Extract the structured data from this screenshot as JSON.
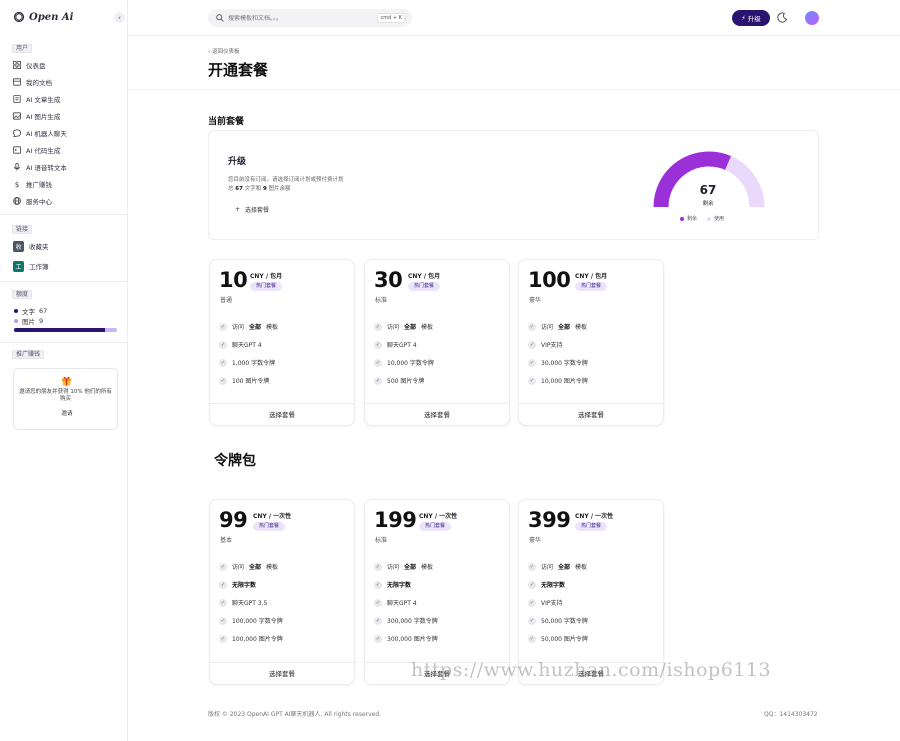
{
  "brand": {
    "name": "Open Ai"
  },
  "sidebar": {
    "section_user": "用户",
    "nav": [
      {
        "label": "仪表盘",
        "icon": "grid-icon"
      },
      {
        "label": "我的文档",
        "icon": "inbox-icon"
      },
      {
        "label": "AI 文章生成",
        "icon": "document-icon"
      },
      {
        "label": "AI 图片生成",
        "icon": "image-icon"
      },
      {
        "label": "AI 机器人聊天",
        "icon": "chat-icon"
      },
      {
        "label": "AI 代码生成",
        "icon": "terminal-icon"
      },
      {
        "label": "AI 语音转文本",
        "icon": "microphone-icon"
      },
      {
        "label": "推广赚钱",
        "icon": "dollar-icon"
      },
      {
        "label": "服务中心",
        "icon": "globe-icon"
      }
    ],
    "section_links": "链接",
    "links": [
      {
        "badge": "收",
        "label": "收藏夹",
        "color": "#4b5563"
      },
      {
        "badge": "工",
        "label": "工作簿",
        "color": "#0f766e"
      }
    ],
    "section_quota": "额度",
    "quota": [
      {
        "label": "文字",
        "value": "67",
        "color": "#2a1470"
      },
      {
        "label": "图片",
        "value": "9",
        "color": "#b79cf0"
      }
    ],
    "quota_fill": 0.88,
    "section_promo": "推广赚钱",
    "promo": {
      "text": "邀请您的朋友并获得 10% 他们的所有购买",
      "button": "邀请"
    }
  },
  "topbar": {
    "search_placeholder": "搜索模板和文档。。。",
    "shortcut": "cmd + K",
    "upgrade": "升级"
  },
  "main": {
    "back": "返回仪表板",
    "title": "开通套餐",
    "current_section": "当前套餐",
    "current": {
      "title": "升级",
      "desc_line1": "您目前没有订阅。请选择订阅计划或预付费计划",
      "desc_prefix": "总",
      "words": "67",
      "desc_mid": "文字和",
      "images": "9",
      "desc_suffix": "图片余额",
      "choose": "选择套餐",
      "gauge_value": "67",
      "gauge_label": "剩余",
      "legend_remaining": "剩余",
      "legend_used": "使用",
      "remaining_fraction": 0.63
    },
    "plans": [
      {
        "price": "10",
        "unit": "CNY / 包月",
        "hot": "热门套餐",
        "tier": "普通",
        "features": [
          {
            "pre": "访问 ",
            "bold": "全部",
            "post": " 模板"
          },
          {
            "pre": "聊天GPT 4",
            "bold": "",
            "post": ""
          },
          {
            "pre": "1,000 字数令牌",
            "bold": "",
            "post": ""
          },
          {
            "pre": "100 图片令牌",
            "bold": "",
            "post": ""
          }
        ],
        "button": "选择套餐"
      },
      {
        "price": "30",
        "unit": "CNY / 包月",
        "hot": "热门套餐",
        "tier": "标准",
        "features": [
          {
            "pre": "访问 ",
            "bold": "全部",
            "post": " 模板"
          },
          {
            "pre": "聊天GPT 4",
            "bold": "",
            "post": ""
          },
          {
            "pre": "10,000 字数令牌",
            "bold": "",
            "post": ""
          },
          {
            "pre": "500 图片令牌",
            "bold": "",
            "post": ""
          }
        ],
        "button": "选择套餐"
      },
      {
        "price": "100",
        "unit": "CNY / 包月",
        "hot": "热门套餐",
        "tier": "豪华",
        "features": [
          {
            "pre": "访问 ",
            "bold": "全部",
            "post": " 模板"
          },
          {
            "pre": "VIP支持",
            "bold": "",
            "post": ""
          },
          {
            "pre": "30,000 字数令牌",
            "bold": "",
            "post": ""
          },
          {
            "pre": "10,000 图片令牌",
            "bold": "",
            "post": ""
          }
        ],
        "button": "选择套餐"
      }
    ],
    "packs_title": "令牌包",
    "packs": [
      {
        "price": "99",
        "unit": "CNY / 一次性",
        "hot": "热门套餐",
        "tier": "基本",
        "features": [
          {
            "pre": "访问 ",
            "bold": "全部",
            "post": " 模板"
          },
          {
            "pre": "",
            "bold": "无限字数",
            "post": ""
          },
          {
            "pre": "聊天GPT 3.5",
            "bold": "",
            "post": ""
          },
          {
            "pre": "100,000 字数令牌",
            "bold": "",
            "post": ""
          },
          {
            "pre": "100,000 图片令牌",
            "bold": "",
            "post": ""
          }
        ],
        "button": "选择套餐"
      },
      {
        "price": "199",
        "unit": "CNY / 一次性",
        "hot": "热门套餐",
        "tier": "标准",
        "features": [
          {
            "pre": "访问 ",
            "bold": "全部",
            "post": " 模板"
          },
          {
            "pre": "",
            "bold": "无限字数",
            "post": ""
          },
          {
            "pre": "聊天GPT 4",
            "bold": "",
            "post": ""
          },
          {
            "pre": "300,000 字数令牌",
            "bold": "",
            "post": ""
          },
          {
            "pre": "300,000 图片令牌",
            "bold": "",
            "post": ""
          }
        ],
        "button": "选择套餐"
      },
      {
        "price": "399",
        "unit": "CNY / 一次性",
        "hot": "热门套餐",
        "tier": "豪华",
        "features": [
          {
            "pre": "访问 ",
            "bold": "全部",
            "post": " 模板"
          },
          {
            "pre": "",
            "bold": "无限字数",
            "post": ""
          },
          {
            "pre": "VIP支持",
            "bold": "",
            "post": ""
          },
          {
            "pre": "50,000 字数令牌",
            "bold": "",
            "post": ""
          },
          {
            "pre": "50,000 图片令牌",
            "bold": "",
            "post": ""
          }
        ],
        "button": "选择套餐"
      }
    ],
    "footer_left": "版权 © 2023 OpenAI GPT AI聊天机器人. All rights reserved.",
    "footer_right": "QQ：1414303472",
    "watermark": "https://www.huzhan.com/ishop6113"
  },
  "colors": {
    "accent": "#2a1470",
    "gauge_main": "#9b30d9",
    "gauge_light": "#ead9fb"
  }
}
